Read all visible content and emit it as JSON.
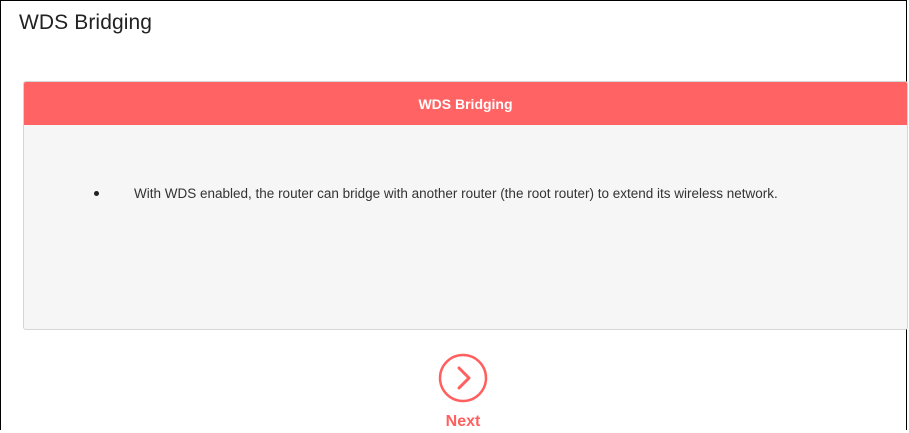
{
  "page": {
    "title": "WDS Bridging"
  },
  "panel": {
    "header": "WDS Bridging",
    "bullets": [
      "With WDS enabled, the router can bridge with another router (the root router) to extend its wireless network."
    ]
  },
  "actions": {
    "next_label": "Next",
    "next_icon": "chevron-right-circle-icon"
  },
  "colors": {
    "accent": "#ff6363",
    "panel_bg": "#f6f6f6",
    "text": "#333333"
  }
}
